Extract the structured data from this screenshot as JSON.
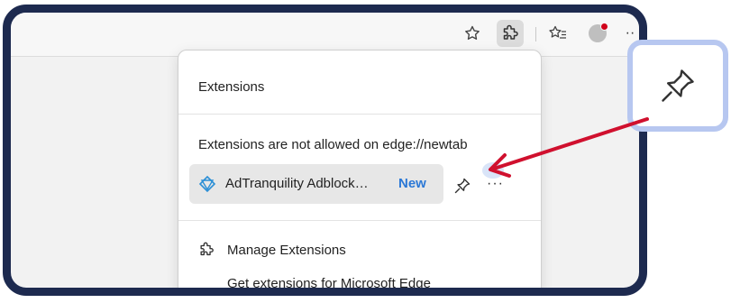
{
  "panel": {
    "title": "Extensions",
    "notice": "Extensions are not allowed on edge://newtab",
    "extension": {
      "name": "AdTranquility Adblock…",
      "badge": "New",
      "more": "···"
    },
    "manage_label": "Manage Extensions",
    "get_label": "Get extensions for Microsoft Edge"
  },
  "toolbar": {
    "more": "··"
  },
  "colors": {
    "frame": "#1d2a4f",
    "badge": "#2b78d6",
    "arrow": "#d0102e",
    "callout_border": "#b7c7f0"
  }
}
